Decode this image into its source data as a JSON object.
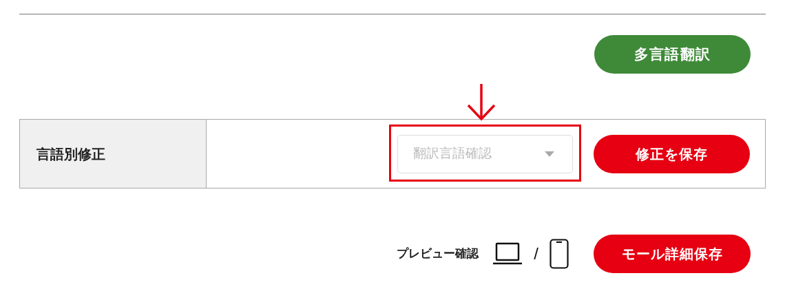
{
  "translate_button": {
    "label": "多言語翻訳"
  },
  "language_edit": {
    "label": "言語別修正",
    "select": {
      "placeholder": "翻訳言語確認",
      "disabled": true
    },
    "save_button": {
      "label": "修正を保存"
    }
  },
  "preview": {
    "label": "プレビュー確認",
    "separator": "/"
  },
  "mall_save_button": {
    "label": "モール詳細保存"
  }
}
